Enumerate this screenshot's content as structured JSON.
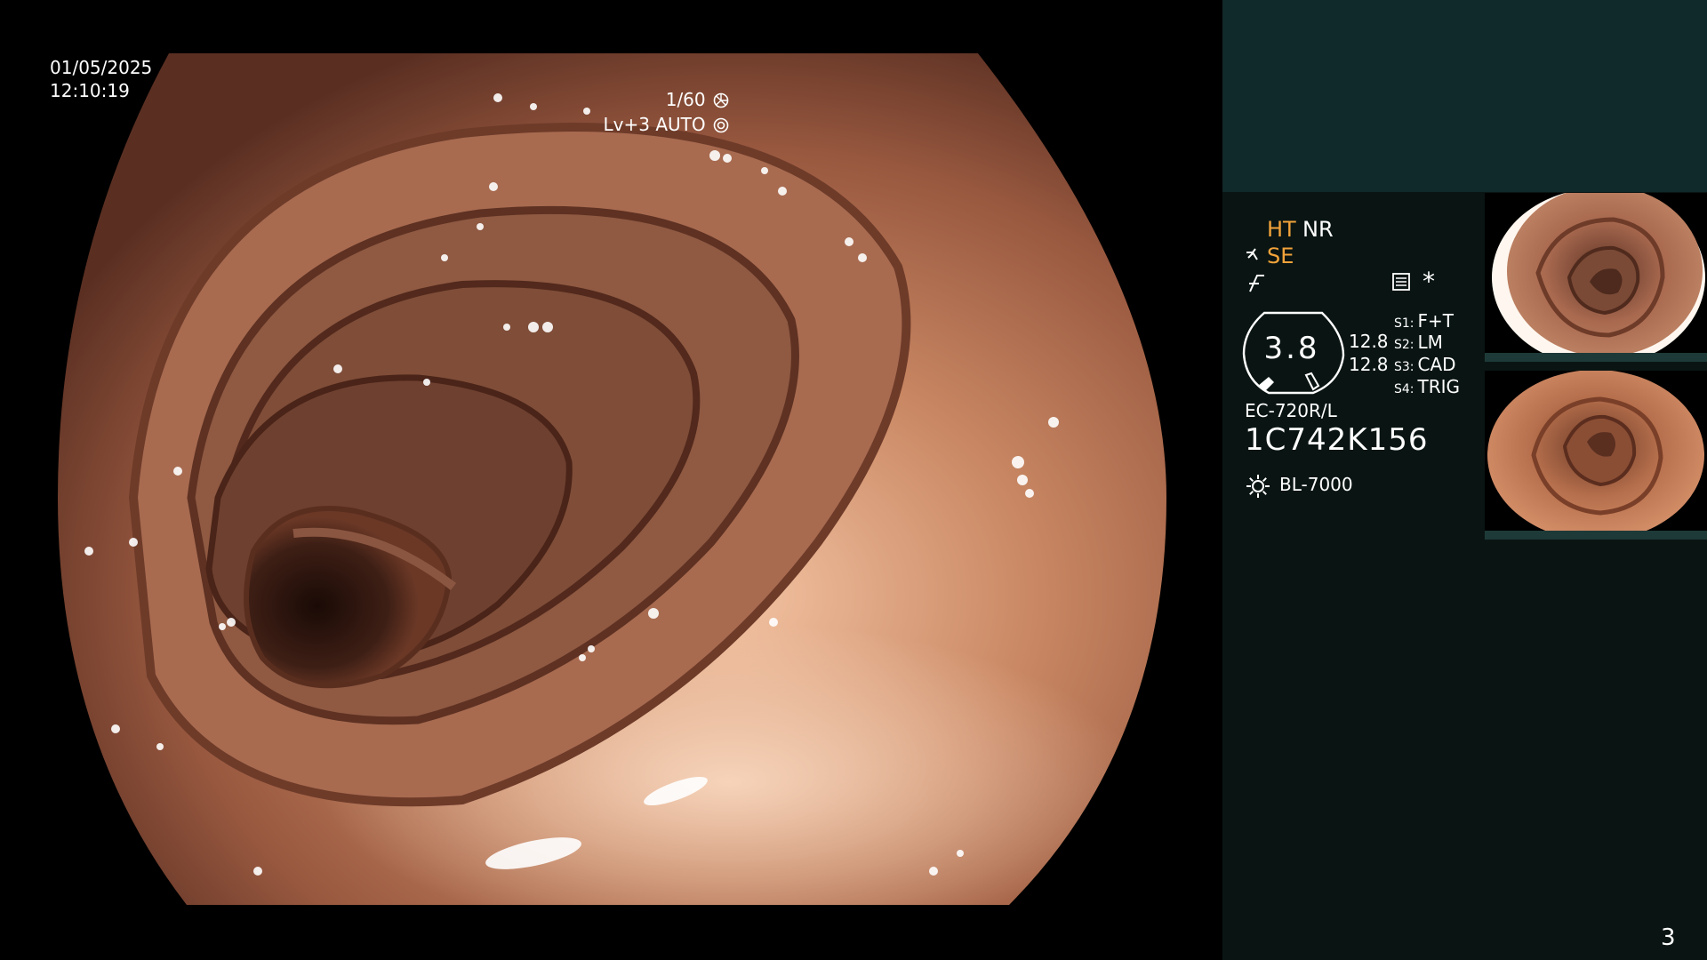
{
  "osd": {
    "date": "01/05/2025",
    "time": "12:10:19",
    "shutter": "1/60",
    "shutter_icon": "aperture-icon",
    "level": "Lv+3 AUTO",
    "level_icon": "auto-iris-icon"
  },
  "panel": {
    "modes": {
      "ht": "HT",
      "nr": "NR",
      "se": "SE",
      "se_icon": "enhancement-icon",
      "f_icon": "filter-icon",
      "struct_icon": "structure-icon",
      "star": "*"
    },
    "zoom": {
      "value": "3.8",
      "a": "12.8",
      "b": "12.8"
    },
    "scope_buttons": [
      {
        "key": "S1:",
        "value": "F+T"
      },
      {
        "key": "S2:",
        "value": "LM"
      },
      {
        "key": "S3:",
        "value": "CAD"
      },
      {
        "key": "S4:",
        "value": "TRIG"
      }
    ],
    "scope_model": "EC-720R/L",
    "scope_serial": "1C742K156",
    "light_icon": "light-source-icon",
    "light_model": "BL-7000"
  },
  "page_number": "3",
  "colors": {
    "panel_top": "#10292a",
    "panel": "#0a1513",
    "highlight": "#f2a33a",
    "text": "#ffffff"
  }
}
